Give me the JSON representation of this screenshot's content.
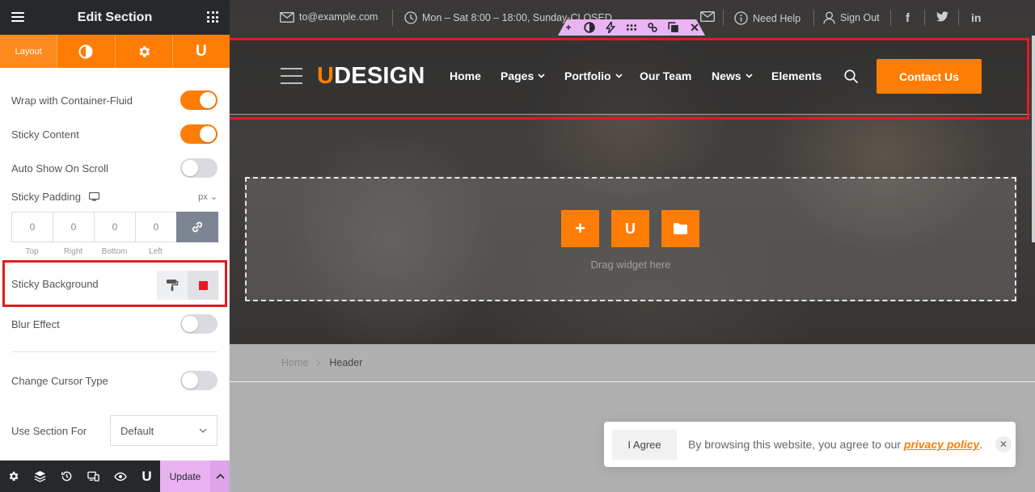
{
  "panel": {
    "title": "Edit Section",
    "tabs": [
      {
        "label": "Layout"
      },
      {
        "icon": "contrast-icon"
      },
      {
        "icon": "gear-icon"
      },
      {
        "icon": "udesign-u-icon",
        "glyph": "U"
      }
    ],
    "controls": {
      "wrap_container": {
        "label": "Wrap with Container-Fluid",
        "on": true
      },
      "sticky_content": {
        "label": "Sticky Content",
        "on": true
      },
      "auto_show": {
        "label": "Auto Show On Scroll",
        "on": false
      },
      "sticky_padding": {
        "label": "Sticky Padding",
        "unit": "px"
      },
      "padding": {
        "values": [
          "0",
          "0",
          "0",
          "0"
        ],
        "labels": [
          "Top",
          "Right",
          "Bottom",
          "Left"
        ]
      },
      "sticky_background": {
        "label": "Sticky Background",
        "color": "#e21b23"
      },
      "blur_effect": {
        "label": "Blur Effect",
        "on": false
      },
      "change_cursor": {
        "label": "Change Cursor Type",
        "on": false
      },
      "use_section_for": {
        "label": "Use Section For",
        "value": "Default"
      }
    },
    "footer": {
      "update_label": "Update",
      "u_glyph": "U"
    }
  },
  "site": {
    "topbar": {
      "email": "to@example.com",
      "hours": "Mon – Sat 8:00 – 18:00, Sunday-CLOSED",
      "need_help": "Need Help",
      "sign_out": "Sign Out",
      "facebook": "f",
      "linkedin": "in"
    },
    "logo": {
      "accent": "U",
      "rest": "DESIGN"
    },
    "nav": [
      "Home",
      "Pages",
      "Portfolio",
      "Our Team",
      "News",
      "Elements"
    ],
    "contact_label": "Contact Us",
    "drop_zone": {
      "text": "Drag widget here",
      "u_glyph": "U"
    },
    "breadcrumb": {
      "home": "Home",
      "current": "Header"
    },
    "cookie": {
      "agree_label": "I Agree",
      "message": "By browsing this website, you agree to our ",
      "link_text": "privacy policy",
      "end": "."
    }
  },
  "colors": {
    "accent": "#ff7d05",
    "panel_dark": "#26292c",
    "highlight": "#e21b23",
    "toolbar": "#eab4f2"
  }
}
